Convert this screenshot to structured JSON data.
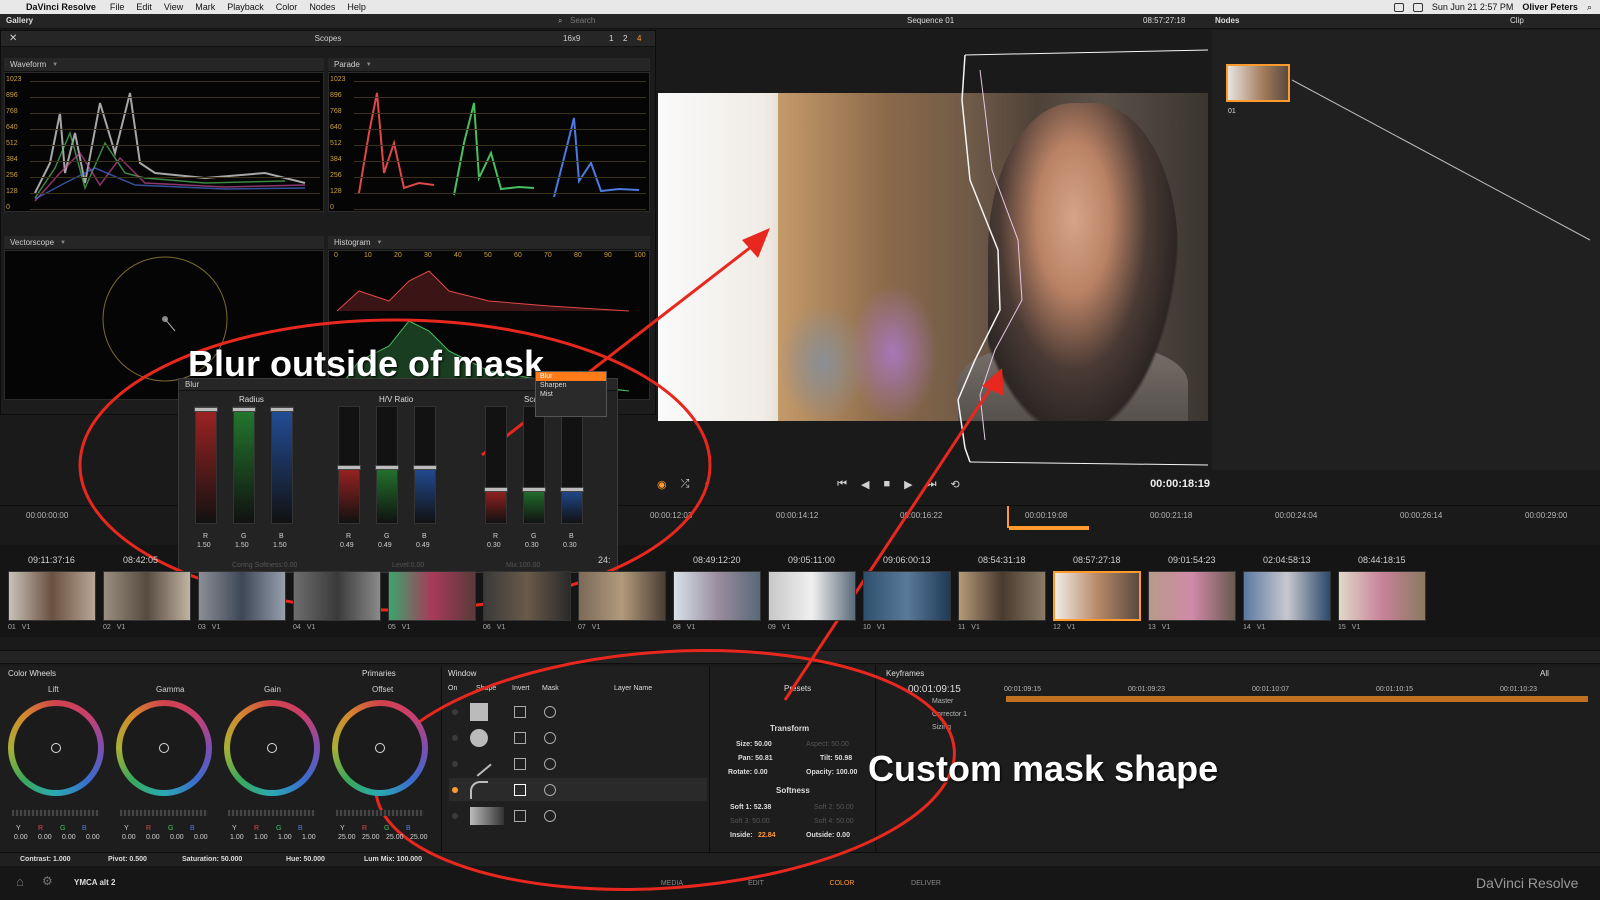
{
  "menubar": {
    "app": "DaVinci Resolve",
    "menus": [
      "File",
      "Edit",
      "View",
      "Mark",
      "Playback",
      "Color",
      "Nodes",
      "Help"
    ],
    "clock": "Sun Jun 21  2:57 PM",
    "user": "Oliver Peters"
  },
  "top": {
    "gallery": "Gallery",
    "search_placeholder": "Search",
    "sequence": "Sequence 01",
    "timecode": "08:57:27:18",
    "nodes": "Nodes",
    "clip": "Clip"
  },
  "scopes": {
    "title": "Scopes",
    "layout": "16x9",
    "pages": [
      "1",
      "2",
      "4"
    ],
    "waveform": "Waveform",
    "parade": "Parade",
    "vectorscope": "Vectorscope",
    "histogram": "Histogram",
    "ticks": [
      "1023",
      "896",
      "768",
      "640",
      "512",
      "384",
      "256",
      "128",
      "0"
    ],
    "hist_ticks": [
      "0",
      "10",
      "20",
      "30",
      "40",
      "50",
      "60",
      "70",
      "80",
      "90",
      "100"
    ]
  },
  "blur_panel": {
    "title": "Blur",
    "mode": "Blur",
    "menu": [
      "Blur",
      "Sharpen",
      "Mist"
    ],
    "groups": [
      {
        "label": "Radius",
        "values": [
          "1.50",
          "1.50",
          "1.50"
        ]
      },
      {
        "label": "H/V Ratio",
        "values": [
          "0.49",
          "0.49",
          "0.49"
        ]
      },
      {
        "label": "Scaling",
        "values": [
          "0.30",
          "0.30",
          "0.30"
        ]
      }
    ],
    "channel_letters": [
      "R",
      "G",
      "B"
    ],
    "footer": [
      "Coring Softness:0.00",
      "Level:0.00",
      "Mix:100.00"
    ]
  },
  "viewer": {
    "timecode": "00:00:18:19",
    "ruler": [
      "00:00:00:00",
      "00:00:12:03",
      "00:00:14:12",
      "00:00:16:22",
      "00:00:19:08",
      "00:00:21:18",
      "00:00:24:04",
      "00:00:26:14",
      "00:00:29:00"
    ]
  },
  "clips": [
    {
      "tc": "09:11:37:16",
      "num": "01",
      "track": "V1"
    },
    {
      "tc": "08:42:05",
      "num": "02",
      "track": "V1"
    },
    {
      "tc": "",
      "num": "03",
      "track": "V1"
    },
    {
      "tc": "",
      "num": "04",
      "track": "V1"
    },
    {
      "tc": "",
      "num": "05",
      "track": "V1"
    },
    {
      "tc": "",
      "num": "06",
      "track": "V1"
    },
    {
      "tc": "24:",
      "num": "07",
      "track": "V1"
    },
    {
      "tc": "08:49:12:20",
      "num": "08",
      "track": "V1"
    },
    {
      "tc": "09:05:11:00",
      "num": "09",
      "track": "V1"
    },
    {
      "tc": "09:06:00:13",
      "num": "10",
      "track": "V1"
    },
    {
      "tc": "08:54:31:18",
      "num": "11",
      "track": "V1"
    },
    {
      "tc": "08:57:27:18",
      "num": "12",
      "track": "V1"
    },
    {
      "tc": "09:01:54:23",
      "num": "13",
      "track": "V1"
    },
    {
      "tc": "02:04:58:13",
      "num": "14",
      "track": "V1"
    },
    {
      "tc": "08:44:18:15",
      "num": "15",
      "track": "V1"
    }
  ],
  "color_wheels": {
    "title": "Color Wheels",
    "mode": "Primaries",
    "wheels": [
      {
        "label": "Lift",
        "values": [
          "0.00",
          "0.00",
          "0.00",
          "0.00"
        ]
      },
      {
        "label": "Gamma",
        "values": [
          "0.00",
          "0.00",
          "0.00",
          "0.00"
        ]
      },
      {
        "label": "Gain",
        "values": [
          "1.00",
          "1.00",
          "1.00",
          "1.00"
        ]
      },
      {
        "label": "Offset",
        "values": [
          "25.00",
          "25.00",
          "25.00",
          "25.00"
        ]
      }
    ],
    "letters": [
      "Y",
      "R",
      "G",
      "B"
    ],
    "bottom": {
      "contrast": "Contrast: 1.000",
      "pivot": "Pivot: 0.500",
      "saturation": "Saturation: 50.000",
      "hue": "Hue: 50.000",
      "lum_mix": "Lum Mix: 100.000"
    }
  },
  "window": {
    "title": "Window",
    "cols": [
      "On",
      "Shape",
      "Invert",
      "Mask",
      "Layer Name"
    ],
    "presets": "Presets",
    "transform": "Transform",
    "size": "Size: 50.00",
    "aspect": "Aspect: 50.00",
    "pan": "Pan: 50.81",
    "tilt": "Tilt: 50.98",
    "rotate": "Rotate: 0.00",
    "opacity": "Opacity: 100.00",
    "softness": "Softness",
    "soft1": "Soft 1: 52.38",
    "soft2": "Soft 2: 50.00",
    "soft3": "Soft 3: 50.00",
    "soft4": "Soft 4: 50.00",
    "inside": "Inside:",
    "inside_val": "22.84",
    "outside": "Outside: 0.00"
  },
  "keyframes": {
    "title": "Keyframes",
    "filter": "All",
    "timecode": "00:01:09:15",
    "ruler": [
      "00:01:09:15",
      "00:01:09:23",
      "00:01:10:07",
      "00:01:10:15",
      "00:01:10:23"
    ],
    "tracks": [
      "Master",
      "Corrector 1",
      "Sizing"
    ]
  },
  "footer": {
    "project": "YMCA alt 2",
    "pages": [
      "MEDIA",
      "EDIT",
      "COLOR",
      "DELIVER"
    ],
    "brand": "DaVinci Resolve"
  },
  "annotations": {
    "blur": "Blur outside of mask",
    "mask": "Custom mask shape"
  },
  "colors": {
    "accent": "#ff9a2e",
    "annotation": "#e8281e",
    "background": "#1a1a1a"
  }
}
